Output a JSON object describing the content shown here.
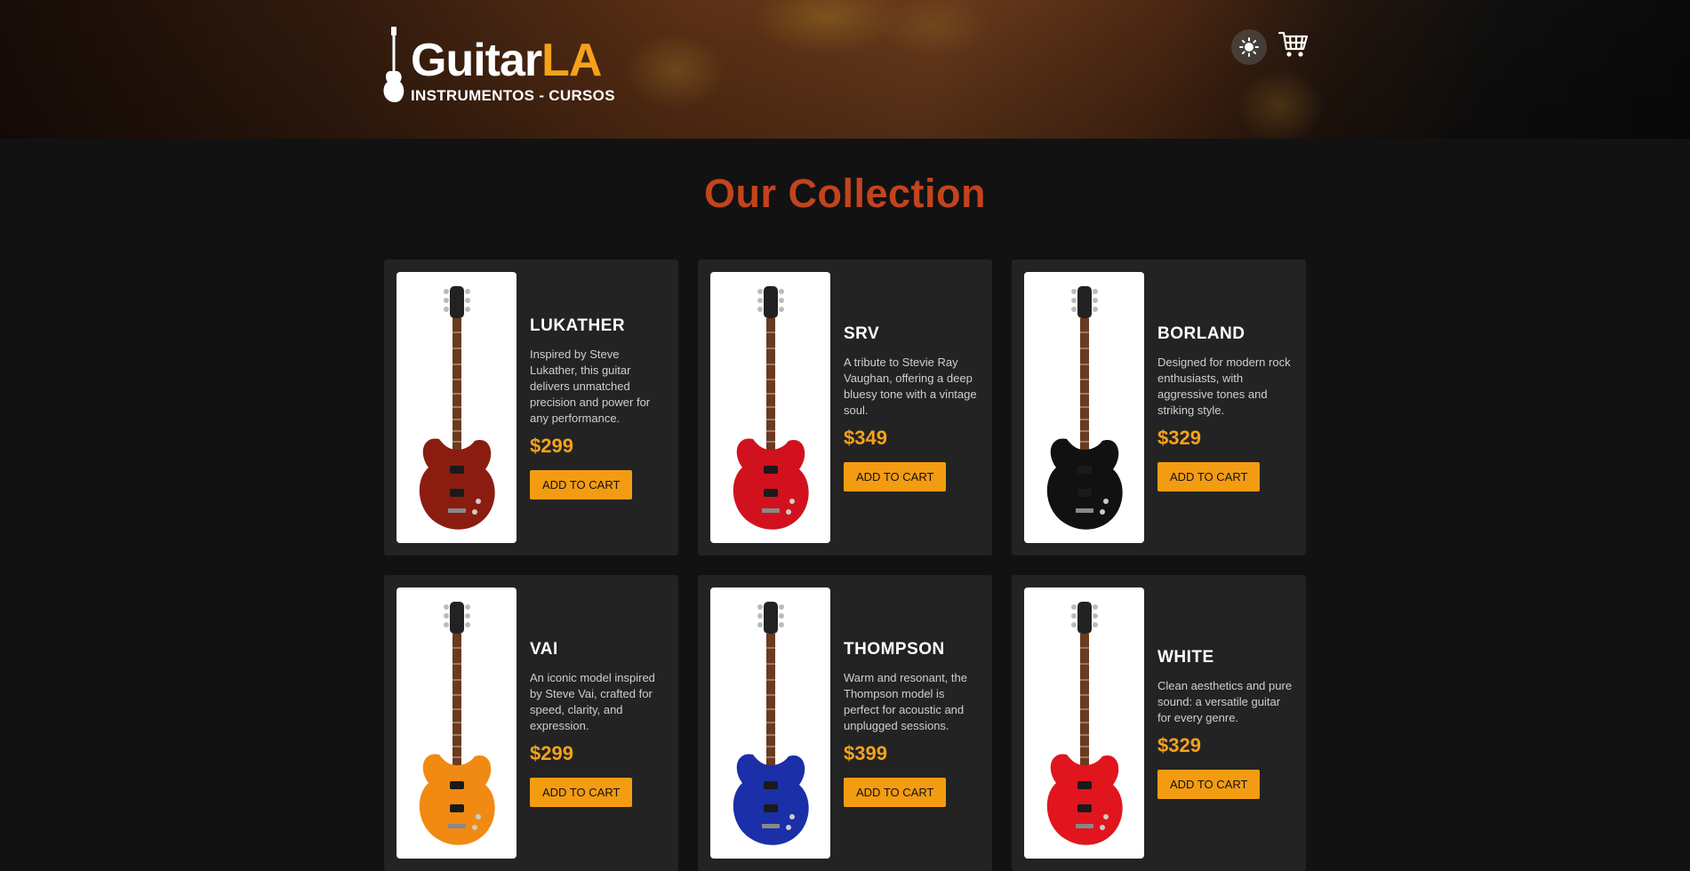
{
  "header": {
    "logo_title_main": "Guitar",
    "logo_title_accent": "LA",
    "logo_subtitle": "INSTRUMENTOS - CURSOS",
    "theme_icon": "sun-icon",
    "cart_icon": "cart-icon"
  },
  "main": {
    "title": "Our Collection",
    "add_to_cart_label": "ADD TO CART",
    "products": [
      {
        "name": "LUKATHER",
        "description": "Inspired by Steve Lukather, this guitar delivers unmatched precision and power for any performance.",
        "price": "$299",
        "body_color": "#8a1d10"
      },
      {
        "name": "SRV",
        "description": "A tribute to Stevie Ray Vaughan, offering a deep bluesy tone with a vintage soul.",
        "price": "$349",
        "body_color": "#d1121e"
      },
      {
        "name": "BORLAND",
        "description": "Designed for modern rock enthusiasts, with aggressive tones and striking style.",
        "price": "$329",
        "body_color": "#111111"
      },
      {
        "name": "VAI",
        "description": "An iconic model inspired by Steve Vai, crafted for speed, clarity, and expression.",
        "price": "$299",
        "body_color": "#f08a12"
      },
      {
        "name": "THOMPSON",
        "description": "Warm and resonant, the Thompson model is perfect for acoustic and unplugged sessions.",
        "price": "$399",
        "body_color": "#1a2fa8"
      },
      {
        "name": "WHITE",
        "description": "Clean aesthetics and pure sound: a versatile guitar for every genre.",
        "price": "$329",
        "body_color": "#e0151e"
      }
    ]
  },
  "colors": {
    "accent": "#f39c12",
    "title": "#c2441e",
    "background": "#121212",
    "card": "#232323"
  }
}
